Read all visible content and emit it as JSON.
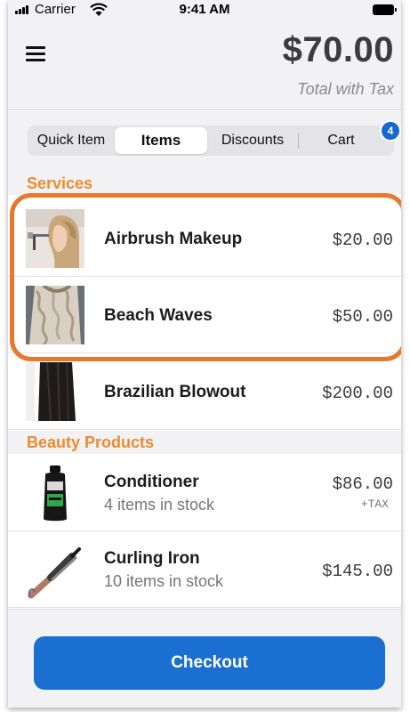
{
  "status_bar": {
    "carrier": "Carrier",
    "time": "9:41 AM"
  },
  "header": {
    "total": "$70.00",
    "caption": "Total with Tax",
    "menu_icon": "hamburger-menu-icon"
  },
  "tabs": [
    {
      "label": "Quick Item",
      "active": false
    },
    {
      "label": "Items",
      "active": true
    },
    {
      "label": "Discounts",
      "active": false
    },
    {
      "label": "Cart",
      "active": false
    }
  ],
  "cart_badge": "4",
  "sections": [
    {
      "title": "Services",
      "items": [
        {
          "name": "Airbrush Makeup",
          "price": "$20.00"
        },
        {
          "name": "Beach Waves",
          "price": "$50.00"
        },
        {
          "name": "Brazilian Blowout",
          "price": "$200.00"
        }
      ]
    },
    {
      "title": "Beauty Products",
      "items": [
        {
          "name": "Conditioner",
          "stock": "4 items in stock",
          "price": "$86.00",
          "tax": "+TAX"
        },
        {
          "name": "Curling Iron",
          "stock": "10 items in stock",
          "price": "$145.00"
        }
      ]
    }
  ],
  "footer": {
    "checkout_label": "Checkout"
  },
  "colors": {
    "accent_orange": "#ee8a30",
    "highlight_orange": "#e7782d",
    "primary_blue": "#1b6fd0",
    "badge_blue": "#1769d0"
  }
}
